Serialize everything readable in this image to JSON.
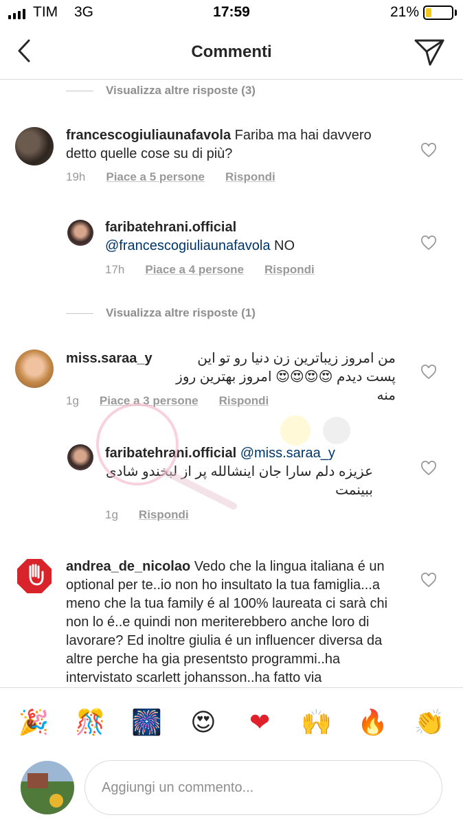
{
  "status_bar": {
    "carrier": "TIM",
    "network": "3G",
    "time": "17:59",
    "battery": "21%",
    "battery_level": 0.21,
    "battery_color": "#f2c81c"
  },
  "header": {
    "title": "Commenti",
    "back_icon": "chevron-left-icon",
    "send_icon": "paper-plane-icon"
  },
  "replies_toggle_1": "Visualizza altre risposte (3)",
  "replies_toggle_2": "Visualizza altre risposte (1)",
  "comments": [
    {
      "username": "francescogiuliaunafavola",
      "text": " Fariba ma hai davvero detto quelle cose su di più?",
      "time": "19h",
      "likes": "Piace a 5 persone",
      "reply": "Rispondi"
    },
    {
      "username": "faribatehrani.official",
      "mention": "@francescogiuliaunafavola",
      "text": " NO",
      "time": "17h",
      "likes": "Piace a 4 persone",
      "reply": "Rispondi"
    },
    {
      "username": "miss.saraa_y",
      "text": "من امروز زیباترین زن دنیا رو تو این پست دیدم 😍😍😍😍 امروز بهترین روز منه",
      "time": "1g",
      "likes": "Piace a 3 persone",
      "reply": "Rispondi"
    },
    {
      "username": "faribatehrani.official",
      "mention": "@miss.saraa_y",
      "text": "عزیزه دلم سارا جان اینشالله پر از لبخندو شادی ببینمت",
      "time": "1g",
      "reply": "Rispondi"
    },
    {
      "username": "andrea_de_nicolao",
      "text": " Vedo che la lingua italiana é un optional per te..io non ho insultato la tua famiglia...a meno che la tua family é al 100% laureata ci sarà chi non lo é..e quindi non meriterebbero anche loro di lavorare? Ed inoltre giulia é un influencer diversa da altre perche ha gia presentsto programmi..ha intervistato scarlett johansson..ha fatto via"
    }
  ],
  "emojis": [
    "🎉",
    "🎊",
    "🎆",
    "😍",
    "❤",
    "🙌",
    "🔥",
    "👏"
  ],
  "composer": {
    "placeholder": "Aggiungi un commento..."
  },
  "colors": {
    "text": "#262626",
    "muted": "#8e8e8e",
    "mention": "#003569",
    "divider": "#dbdbdb"
  }
}
